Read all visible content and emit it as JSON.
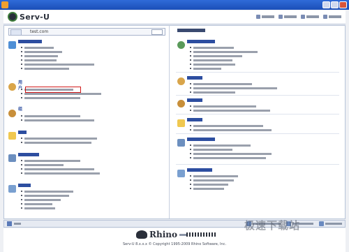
{
  "window": {
    "title": ""
  },
  "header": {
    "brand": "Serv-U",
    "links": [
      "",
      "",
      "",
      ""
    ]
  },
  "left": {
    "domain_label": "",
    "domain_value": "test.com",
    "sections": [
      {
        "name": "domain-info",
        "icon": "globe-icon",
        "rows": 6
      },
      {
        "name": "users",
        "title": "用户",
        "icon": "user-icon",
        "rows": 3
      },
      {
        "name": "groups",
        "title": "组",
        "icon": "group-icon",
        "rows": 2
      },
      {
        "name": "directories",
        "icon": "folder-icon",
        "rows": 2
      },
      {
        "name": "limits",
        "icon": "limits-icon",
        "rows": 4
      },
      {
        "name": "logs",
        "icon": "log-icon",
        "rows": 5
      }
    ]
  },
  "right": {
    "header": "",
    "sections": [
      {
        "name": "server-settings",
        "icon": "server-icon",
        "rows": 6
      },
      {
        "name": "server-users",
        "icon": "user-icon",
        "rows": 3
      },
      {
        "name": "server-groups",
        "icon": "group-icon",
        "rows": 2
      },
      {
        "name": "server-dirs",
        "icon": "folder-icon",
        "rows": 2
      },
      {
        "name": "server-limits",
        "icon": "limits-icon",
        "rows": 4
      },
      {
        "name": "server-logs",
        "icon": "log-icon",
        "rows": 4
      }
    ]
  },
  "status": {
    "left": "",
    "items": [
      "",
      "",
      ""
    ]
  },
  "footer": {
    "brand": "Rhino",
    "copyright": "Serv-U 8.x.x.x © Copyright 1995-2009 Rhino Software, Inc."
  },
  "watermark": "极速下载站"
}
